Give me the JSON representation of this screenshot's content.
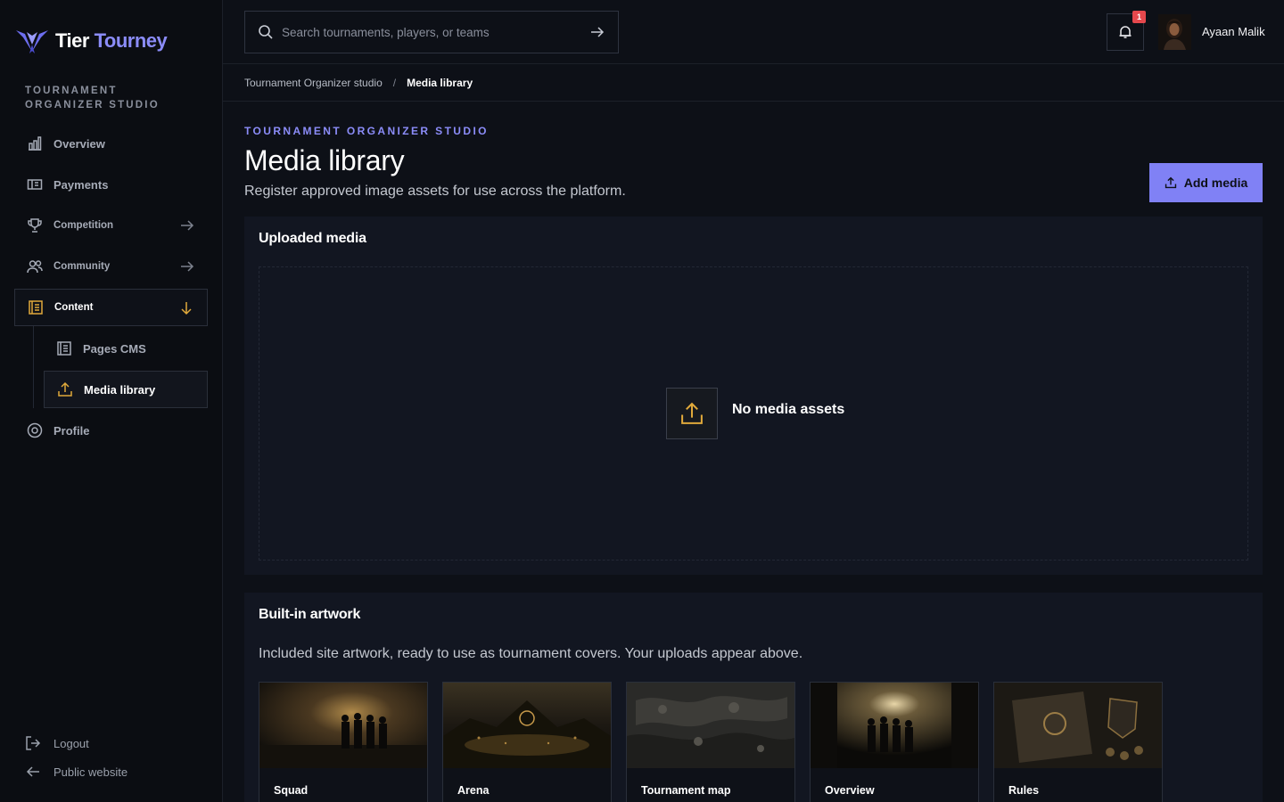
{
  "brand": {
    "name_part1": "Tier",
    "name_part2": "Tourney"
  },
  "sidebar": {
    "section_label": "TOURNAMENT ORGANIZER STUDIO",
    "items": [
      {
        "label": "Overview",
        "icon": "bar-chart-icon"
      },
      {
        "label": "Payments",
        "icon": "ticket-icon"
      },
      {
        "label": "Competition",
        "icon": "trophy-icon"
      },
      {
        "label": "Community",
        "icon": "users-icon"
      },
      {
        "label": "Content",
        "icon": "document-icon"
      },
      {
        "label": "Profile",
        "icon": "gear-icon"
      }
    ],
    "sub_items": [
      {
        "label": "Pages CMS",
        "icon": "document-icon"
      },
      {
        "label": "Media library",
        "icon": "upload-icon"
      }
    ],
    "logout": "Logout",
    "public_website": "Public website"
  },
  "topbar": {
    "search_placeholder": "Search tournaments, players, or teams",
    "notification_count": "1",
    "username": "Ayaan Malik"
  },
  "breadcrumb": {
    "parent": "Tournament Organizer studio",
    "separator": "/",
    "current": "Media library"
  },
  "header": {
    "eyebrow": "TOURNAMENT ORGANIZER STUDIO",
    "title": "Media library",
    "subtitle": "Register approved image assets for use across the platform.",
    "add_button": "Add media"
  },
  "uploaded": {
    "title": "Uploaded media",
    "empty_text": "No media assets"
  },
  "builtin": {
    "title": "Built-in artwork",
    "description": "Included site artwork, ready to use as tournament covers. Your uploads appear above.",
    "cards": [
      {
        "label": "Squad"
      },
      {
        "label": "Arena"
      },
      {
        "label": "Tournament map"
      },
      {
        "label": "Overview"
      },
      {
        "label": "Rules"
      }
    ]
  },
  "colors": {
    "accent": "#8081f5",
    "brand_purple": "#8b8cf8",
    "gold": "#e0a93b",
    "badge": "#e5484d",
    "background": "#0d1017",
    "panel": "#121621"
  }
}
